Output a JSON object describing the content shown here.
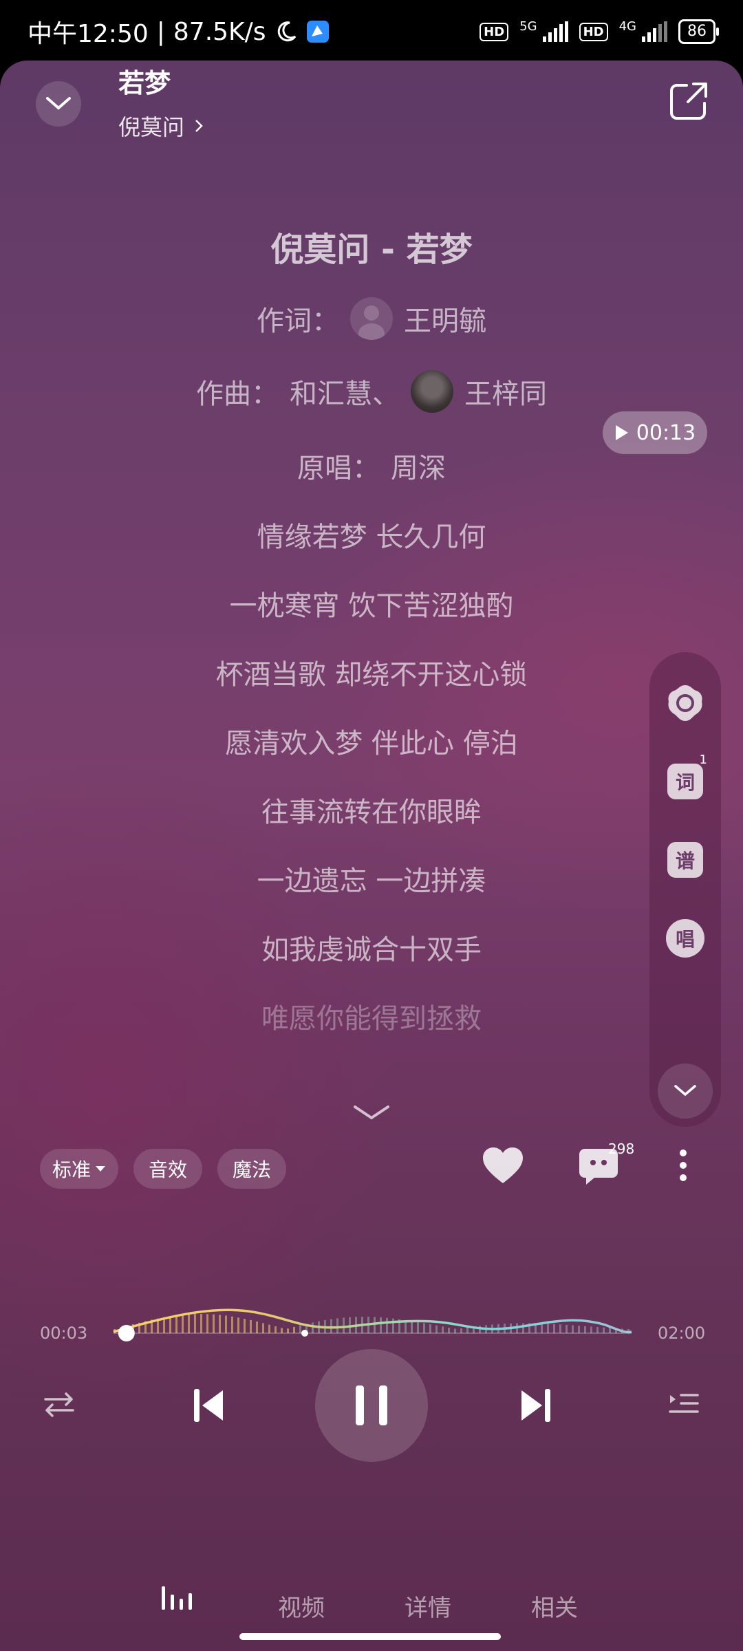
{
  "status_bar": {
    "time": "中午12:50",
    "speed": "87.5K/s",
    "net1": "5G",
    "net2": "4G",
    "hd": "HD",
    "battery": "86"
  },
  "header": {
    "song_title": "若梦",
    "artist": "倪莫问"
  },
  "lyrics": {
    "title": "倪莫问 - 若梦",
    "lyricist_label": "作词：",
    "lyricist": "王明毓",
    "composer_label": "作曲：",
    "composer1": "和汇慧、",
    "composer2": "王梓同",
    "original_label": "原唱：",
    "original_singer": "周深",
    "lines": [
      "情缘若梦 长久几何",
      "一枕寒宵 饮下苦涩独酌",
      "杯酒当歌 却绕不开这心锁",
      "愿清欢入梦 伴此心 停泊",
      "往事流转在你眼眸",
      "一边遗忘 一边拼凑",
      "如我虔诚合十双手",
      "唯愿你能得到拯救"
    ]
  },
  "time_pill": "00:13",
  "side_panel": {
    "lyrics_label": "词",
    "lyrics_badge": "1",
    "score_label": "谱",
    "sing_label": "唱"
  },
  "chips": {
    "quality": "标准",
    "effect": "音效",
    "magic": "魔法"
  },
  "comment_count": "298",
  "progress": {
    "current": "00:03",
    "total": "02:00",
    "fraction": 0.025
  },
  "tabs": [
    "视频",
    "详情",
    "相关"
  ],
  "colors": {
    "bg_top": "#5e3a65",
    "bg_bottom": "#5c2c50",
    "accent_text": "#6d3d69"
  }
}
